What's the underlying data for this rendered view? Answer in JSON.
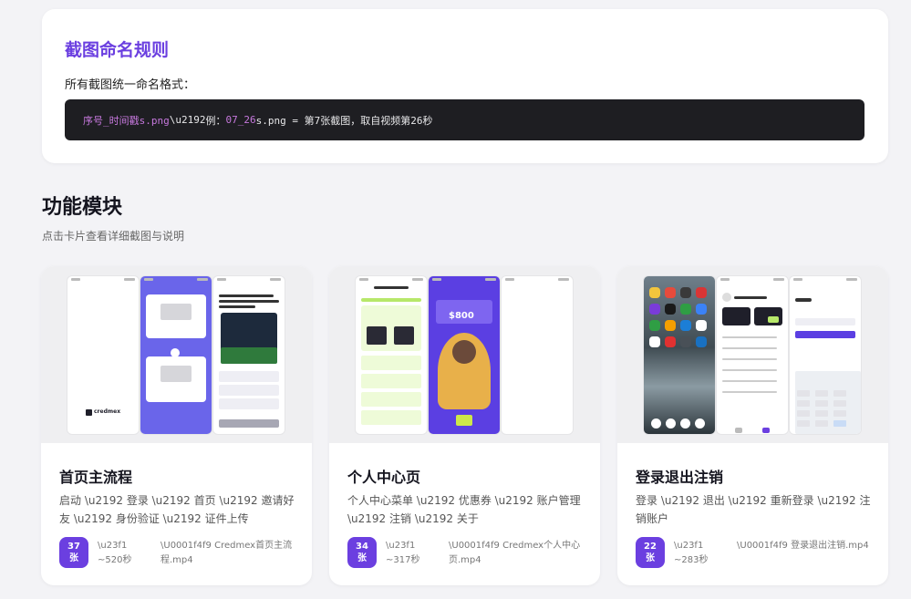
{
  "naming": {
    "title": "截图命名规则",
    "desc": "所有截图统一命名格式：",
    "code_pattern": "序号_时间戳s.png",
    "code_arrow": "\\u2192",
    "code_example_prefix": "例：",
    "code_example_file": "07_26",
    "code_example_suffix": "s.png = 第7张截图，取自视频第26秒"
  },
  "section": {
    "title": "功能模块",
    "subtitle": "点击卡片查看详细截图与说明"
  },
  "modules": [
    {
      "name": "首页主流程",
      "flow": "启动 \\u2192 登录 \\u2192 首页 \\u2192 邀请好友 \\u2192 身份验证 \\u2192 证件上传",
      "count_num": "37",
      "count_unit": "张",
      "duration": "\\u23f1 ~520秒",
      "video": "\\U0001f4f9 Credmex首页主流程.mp4",
      "thumbs": [
        "thumb-splash",
        "thumb-home",
        "thumb-detail"
      ]
    },
    {
      "name": "个人中心页",
      "flow": "个人中心菜单 \\u2192 优惠券 \\u2192 账户管理 \\u2192 注销 \\u2192 关于",
      "count_num": "34",
      "count_unit": "张",
      "duration": "\\u23f1 ~317秒",
      "video": "\\U0001f4f9 Credmex个人中心页.mp4",
      "thumbs": [
        "thumb-identity",
        "thumb-invite",
        "thumb-blank"
      ]
    },
    {
      "name": "登录退出注销",
      "flow": "登录 \\u2192 退出 \\u2192 重新登录 \\u2192 注销账户",
      "count_num": "22",
      "count_unit": "张",
      "duration": "\\u23f1 ~283秒",
      "video": "\\U0001f4f9 登录退出注销.mp4",
      "thumbs": [
        "thumb-launcher",
        "thumb-profile",
        "thumb-login"
      ]
    }
  ],
  "thumb_texts": {
    "brand": "credmex",
    "invite_amount": "$800"
  },
  "colors": {
    "accent": "#6b3fe0",
    "code_bg": "#1e1e22",
    "card_bg": "#ffffff",
    "page_bg": "#f3f3f6"
  }
}
